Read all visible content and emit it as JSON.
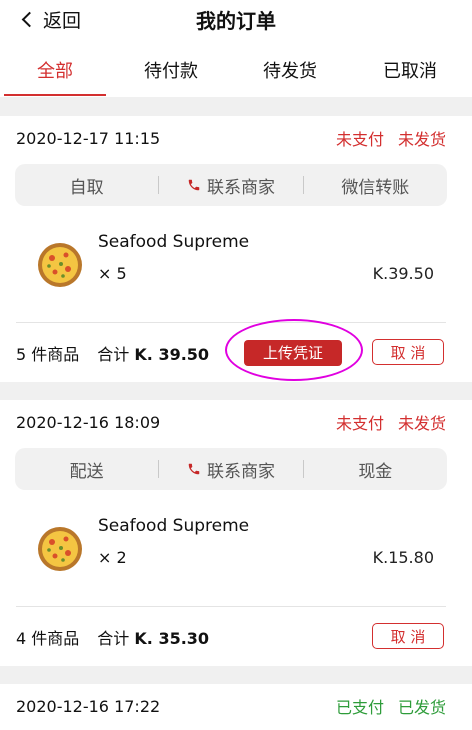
{
  "header": {
    "back_label": "返回",
    "title": "我的订单",
    "tabs": [
      {
        "label": "全部",
        "active": true
      },
      {
        "label": "待付款",
        "active": false
      },
      {
        "label": "待发货",
        "active": false
      },
      {
        "label": "已取消",
        "active": false
      }
    ]
  },
  "orders": [
    {
      "date": "2020-12-17 11:15",
      "status": [
        "未支付",
        "未发货"
      ],
      "actions": [
        "自取",
        "联系商家",
        "微信转账"
      ],
      "product": {
        "name": "Seafood Supreme",
        "qty": "× 5",
        "price": "K.39.50"
      },
      "summary_count": "5 件商品",
      "summary_total_label": "合计",
      "summary_total_value": "K. 39.50",
      "upload_label": "上传凭证",
      "cancel_label": "取 消"
    },
    {
      "date": "2020-12-16 18:09",
      "status": [
        "未支付",
        "未发货"
      ],
      "actions": [
        "配送",
        "联系商家",
        "现金"
      ],
      "product": {
        "name": "Seafood Supreme",
        "qty": "× 2",
        "price": "K.15.80"
      },
      "summary_count": "4 件商品",
      "summary_total_label": "合计",
      "summary_total_value": "K. 35.30",
      "cancel_label": "取 消"
    },
    {
      "date": "2020-12-16 17:22",
      "status": [
        "已支付",
        "已发货"
      ]
    }
  ],
  "colors": {
    "accent": "#d32f2f",
    "paid": "#2e9c3a",
    "highlight": "#e000e0"
  }
}
